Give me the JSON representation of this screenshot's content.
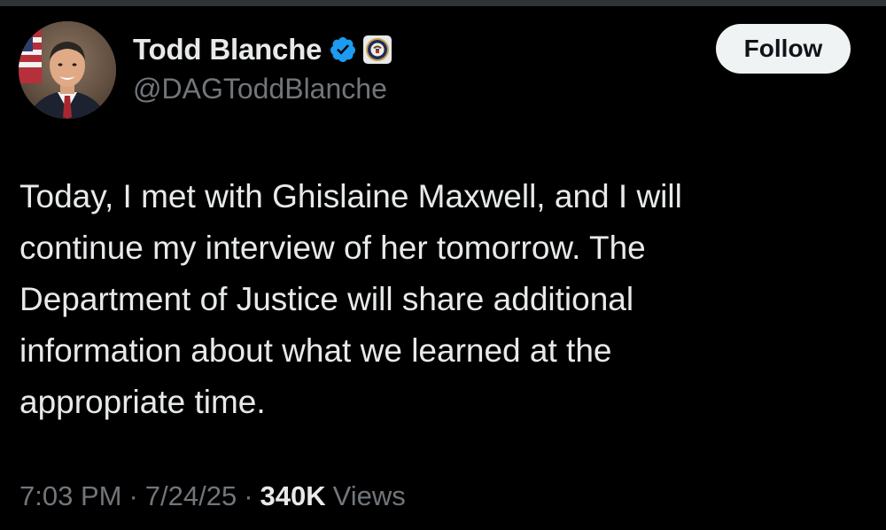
{
  "author": {
    "display_name": "Todd Blanche",
    "handle": "@DAGToddBlanche",
    "verified_icon": "verified-badge-icon",
    "affiliation_icon": "doj-seal-icon",
    "avatar": "profile-photo"
  },
  "follow_button": {
    "label": "Follow"
  },
  "tweet": {
    "text": "Today, I met with Ghislaine Maxwell, and I will\ncontinue my interview of her tomorrow. The\nDepartment of Justice will share additional\ninformation about what we learned at the\nappropriate time."
  },
  "meta": {
    "time": "7:03 PM",
    "separator": "·",
    "date": "7/24/25",
    "views_count": "340K",
    "views_label": "Views"
  },
  "colors": {
    "background": "#000000",
    "text_primary": "#e7e9ea",
    "text_secondary": "#71767b",
    "verified_blue": "#1d9bf0",
    "follow_bg": "#eff3f4"
  }
}
